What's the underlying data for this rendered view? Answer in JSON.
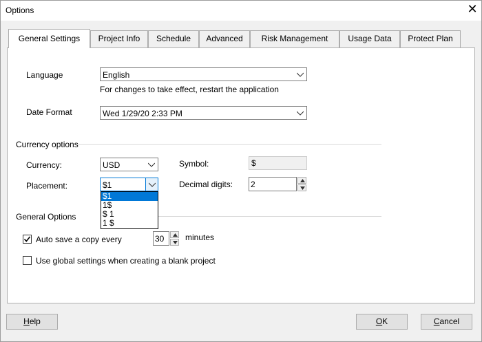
{
  "window": {
    "title": "Options",
    "close_glyph": "✕"
  },
  "tabs": [
    {
      "label": "General Settings",
      "active": true
    },
    {
      "label": "Project Info"
    },
    {
      "label": "Schedule"
    },
    {
      "label": "Advanced"
    },
    {
      "label": "Risk Management"
    },
    {
      "label": "Usage Data"
    },
    {
      "label": "Protect Plan"
    }
  ],
  "language": {
    "label": "Language",
    "value": "English",
    "note": "For changes to take effect, restart the application"
  },
  "date_format": {
    "label": "Date Format",
    "value": "Wed 1/29/20 2:33 PM"
  },
  "currency": {
    "section_title": "Currency options",
    "currency_label": "Currency:",
    "currency_value": "USD",
    "symbol_label": "Symbol:",
    "symbol_value": "$",
    "placement_label": "Placement:",
    "placement_value": "$1",
    "placement_options": [
      "$1",
      "1$",
      "$ 1",
      "1 $"
    ],
    "placement_selected_index": 0,
    "decimal_label": "Decimal digits:",
    "decimal_value": "2"
  },
  "general_options": {
    "section_title": "General Options",
    "autosave_label_prefix": "Auto save a copy every",
    "autosave_checked": true,
    "autosave_value": "30",
    "autosave_unit": "minutes",
    "global_settings_label": "Use global settings when creating a blank project",
    "global_settings_checked": false
  },
  "buttons": {
    "help_prefix": "",
    "help_u": "H",
    "help_rest": "elp",
    "ok_u": "O",
    "ok_rest": "K",
    "cancel_u": "C",
    "cancel_rest": "ancel"
  }
}
